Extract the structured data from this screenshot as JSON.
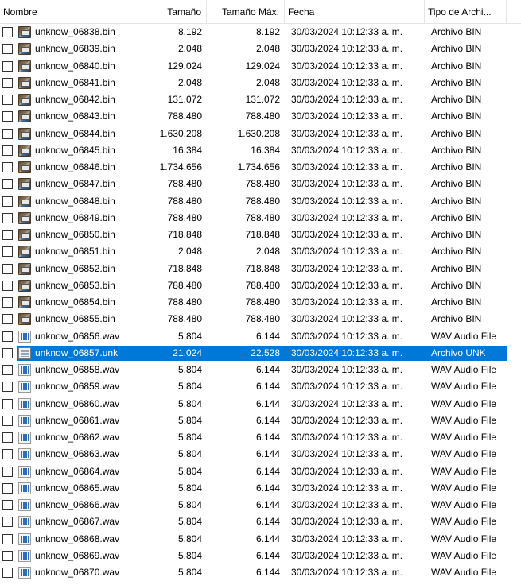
{
  "columns": {
    "name": "Nombre",
    "size": "Tamaño",
    "max_size": "Tamaño Máx.",
    "date": "Fecha",
    "type": "Tipo de Archi..."
  },
  "colors": {
    "selection": "#0078d7",
    "selection_text": "#ffffff"
  },
  "rows": [
    {
      "name": "unknow_06838.bin",
      "size": "8.192",
      "max": "8.192",
      "date": "30/03/2024 10:12:33 a. m.",
      "type": "Archivo BIN",
      "icon": "bin-file-icon",
      "selected": false
    },
    {
      "name": "unknow_06839.bin",
      "size": "2.048",
      "max": "2.048",
      "date": "30/03/2024 10:12:33 a. m.",
      "type": "Archivo BIN",
      "icon": "bin-file-icon",
      "selected": false
    },
    {
      "name": "unknow_06840.bin",
      "size": "129.024",
      "max": "129.024",
      "date": "30/03/2024 10:12:33 a. m.",
      "type": "Archivo BIN",
      "icon": "bin-file-icon",
      "selected": false
    },
    {
      "name": "unknow_06841.bin",
      "size": "2.048",
      "max": "2.048",
      "date": "30/03/2024 10:12:33 a. m.",
      "type": "Archivo BIN",
      "icon": "bin-file-icon",
      "selected": false
    },
    {
      "name": "unknow_06842.bin",
      "size": "131.072",
      "max": "131.072",
      "date": "30/03/2024 10:12:33 a. m.",
      "type": "Archivo BIN",
      "icon": "bin-file-icon",
      "selected": false
    },
    {
      "name": "unknow_06843.bin",
      "size": "788.480",
      "max": "788.480",
      "date": "30/03/2024 10:12:33 a. m.",
      "type": "Archivo BIN",
      "icon": "bin-file-icon",
      "selected": false
    },
    {
      "name": "unknow_06844.bin",
      "size": "1.630.208",
      "max": "1.630.208",
      "date": "30/03/2024 10:12:33 a. m.",
      "type": "Archivo BIN",
      "icon": "bin-file-icon",
      "selected": false
    },
    {
      "name": "unknow_06845.bin",
      "size": "16.384",
      "max": "16.384",
      "date": "30/03/2024 10:12:33 a. m.",
      "type": "Archivo BIN",
      "icon": "bin-file-icon",
      "selected": false
    },
    {
      "name": "unknow_06846.bin",
      "size": "1.734.656",
      "max": "1.734.656",
      "date": "30/03/2024 10:12:33 a. m.",
      "type": "Archivo BIN",
      "icon": "bin-file-icon",
      "selected": false
    },
    {
      "name": "unknow_06847.bin",
      "size": "788.480",
      "max": "788.480",
      "date": "30/03/2024 10:12:33 a. m.",
      "type": "Archivo BIN",
      "icon": "bin-file-icon",
      "selected": false
    },
    {
      "name": "unknow_06848.bin",
      "size": "788.480",
      "max": "788.480",
      "date": "30/03/2024 10:12:33 a. m.",
      "type": "Archivo BIN",
      "icon": "bin-file-icon",
      "selected": false
    },
    {
      "name": "unknow_06849.bin",
      "size": "788.480",
      "max": "788.480",
      "date": "30/03/2024 10:12:33 a. m.",
      "type": "Archivo BIN",
      "icon": "bin-file-icon",
      "selected": false
    },
    {
      "name": "unknow_06850.bin",
      "size": "718.848",
      "max": "718.848",
      "date": "30/03/2024 10:12:33 a. m.",
      "type": "Archivo BIN",
      "icon": "bin-file-icon",
      "selected": false
    },
    {
      "name": "unknow_06851.bin",
      "size": "2.048",
      "max": "2.048",
      "date": "30/03/2024 10:12:33 a. m.",
      "type": "Archivo BIN",
      "icon": "bin-file-icon",
      "selected": false
    },
    {
      "name": "unknow_06852.bin",
      "size": "718.848",
      "max": "718.848",
      "date": "30/03/2024 10:12:33 a. m.",
      "type": "Archivo BIN",
      "icon": "bin-file-icon",
      "selected": false
    },
    {
      "name": "unknow_06853.bin",
      "size": "788.480",
      "max": "788.480",
      "date": "30/03/2024 10:12:33 a. m.",
      "type": "Archivo BIN",
      "icon": "bin-file-icon",
      "selected": false
    },
    {
      "name": "unknow_06854.bin",
      "size": "788.480",
      "max": "788.480",
      "date": "30/03/2024 10:12:33 a. m.",
      "type": "Archivo BIN",
      "icon": "bin-file-icon",
      "selected": false
    },
    {
      "name": "unknow_06855.bin",
      "size": "788.480",
      "max": "788.480",
      "date": "30/03/2024 10:12:33 a. m.",
      "type": "Archivo BIN",
      "icon": "bin-file-icon",
      "selected": false
    },
    {
      "name": "unknow_06856.wav",
      "size": "5.804",
      "max": "6.144",
      "date": "30/03/2024 10:12:33 a. m.",
      "type": "WAV Audio File",
      "icon": "wav-file-icon",
      "selected": false
    },
    {
      "name": "unknow_06857.unk",
      "size": "21.024",
      "max": "22.528",
      "date": "30/03/2024 10:12:33 a. m.",
      "type": "Archivo UNK",
      "icon": "unk-file-icon",
      "selected": true
    },
    {
      "name": "unknow_06858.wav",
      "size": "5.804",
      "max": "6.144",
      "date": "30/03/2024 10:12:33 a. m.",
      "type": "WAV Audio File",
      "icon": "wav-file-icon",
      "selected": false
    },
    {
      "name": "unknow_06859.wav",
      "size": "5.804",
      "max": "6.144",
      "date": "30/03/2024 10:12:33 a. m.",
      "type": "WAV Audio File",
      "icon": "wav-file-icon",
      "selected": false
    },
    {
      "name": "unknow_06860.wav",
      "size": "5.804",
      "max": "6.144",
      "date": "30/03/2024 10:12:33 a. m.",
      "type": "WAV Audio File",
      "icon": "wav-file-icon",
      "selected": false
    },
    {
      "name": "unknow_06861.wav",
      "size": "5.804",
      "max": "6.144",
      "date": "30/03/2024 10:12:33 a. m.",
      "type": "WAV Audio File",
      "icon": "wav-file-icon",
      "selected": false
    },
    {
      "name": "unknow_06862.wav",
      "size": "5.804",
      "max": "6.144",
      "date": "30/03/2024 10:12:33 a. m.",
      "type": "WAV Audio File",
      "icon": "wav-file-icon",
      "selected": false
    },
    {
      "name": "unknow_06863.wav",
      "size": "5.804",
      "max": "6.144",
      "date": "30/03/2024 10:12:33 a. m.",
      "type": "WAV Audio File",
      "icon": "wav-file-icon",
      "selected": false
    },
    {
      "name": "unknow_06864.wav",
      "size": "5.804",
      "max": "6.144",
      "date": "30/03/2024 10:12:33 a. m.",
      "type": "WAV Audio File",
      "icon": "wav-file-icon",
      "selected": false
    },
    {
      "name": "unknow_06865.wav",
      "size": "5.804",
      "max": "6.144",
      "date": "30/03/2024 10:12:33 a. m.",
      "type": "WAV Audio File",
      "icon": "wav-file-icon",
      "selected": false
    },
    {
      "name": "unknow_06866.wav",
      "size": "5.804",
      "max": "6.144",
      "date": "30/03/2024 10:12:33 a. m.",
      "type": "WAV Audio File",
      "icon": "wav-file-icon",
      "selected": false
    },
    {
      "name": "unknow_06867.wav",
      "size": "5.804",
      "max": "6.144",
      "date": "30/03/2024 10:12:33 a. m.",
      "type": "WAV Audio File",
      "icon": "wav-file-icon",
      "selected": false
    },
    {
      "name": "unknow_06868.wav",
      "size": "5.804",
      "max": "6.144",
      "date": "30/03/2024 10:12:33 a. m.",
      "type": "WAV Audio File",
      "icon": "wav-file-icon",
      "selected": false
    },
    {
      "name": "unknow_06869.wav",
      "size": "5.804",
      "max": "6.144",
      "date": "30/03/2024 10:12:33 a. m.",
      "type": "WAV Audio File",
      "icon": "wav-file-icon",
      "selected": false
    },
    {
      "name": "unknow_06870.wav",
      "size": "5.804",
      "max": "6.144",
      "date": "30/03/2024 10:12:33 a. m.",
      "type": "WAV Audio File",
      "icon": "wav-file-icon",
      "selected": false
    }
  ]
}
